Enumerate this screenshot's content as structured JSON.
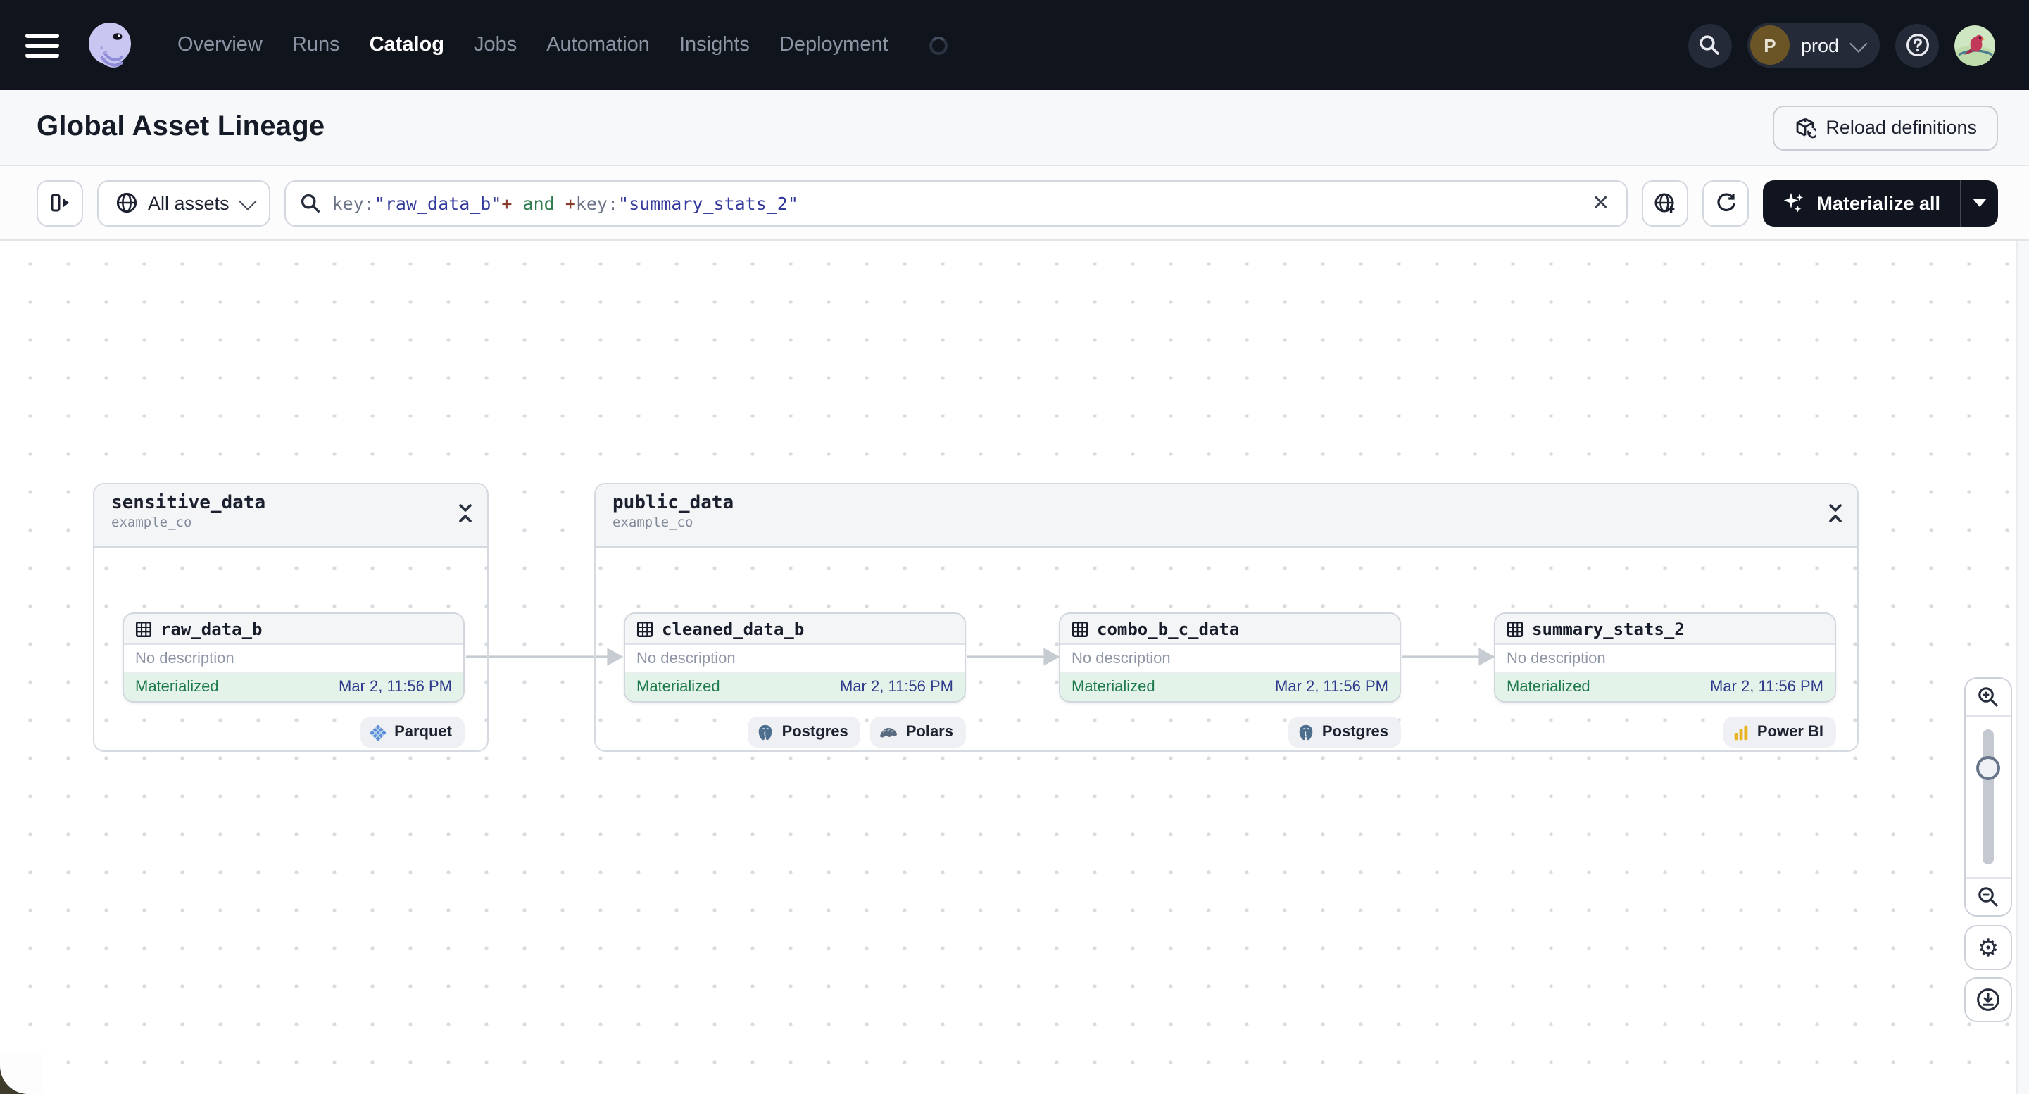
{
  "colors": {
    "nav_bg": "#10141d",
    "primary_button_bg": "#10151f",
    "materialized_green": "#1e7a4c",
    "materialized_bg": "#e4f3ea",
    "timestamp_indigo": "#2e3a8a",
    "query_key": "#6b7487",
    "query_string": "#343a9b",
    "query_operator_plus": "#8a3b2e",
    "query_operator_and": "#2f7d4e"
  },
  "nav": {
    "items": [
      "Overview",
      "Runs",
      "Catalog",
      "Jobs",
      "Automation",
      "Insights",
      "Deployment"
    ],
    "active_item": "Catalog",
    "deployment_switcher": {
      "initial": "P",
      "label": "prod"
    }
  },
  "header": {
    "title": "Global Asset Lineage",
    "reload_button_label": "Reload definitions"
  },
  "toolbar": {
    "scope_button_label": "All assets",
    "search_query": "key:\"raw_data_b\"+ and +key:\"summary_stats_2\"",
    "search_tokens": [
      "key:",
      "\"raw_data_b\"",
      "+",
      " and ",
      "+",
      "key:",
      "\"summary_stats_2\""
    ],
    "materialize_button_label": "Materialize all"
  },
  "graph": {
    "groups": [
      {
        "name": "sensitive_data",
        "location": "example_co",
        "assets": [
          {
            "name": "raw_data_b",
            "description": "No description",
            "status": "Materialized",
            "timestamp": "Mar 2, 11:56 PM",
            "tags": [
              {
                "label": "Parquet",
                "icon": "parquet-icon"
              }
            ]
          }
        ]
      },
      {
        "name": "public_data",
        "location": "example_co",
        "assets": [
          {
            "name": "cleaned_data_b",
            "description": "No description",
            "status": "Materialized",
            "timestamp": "Mar 2, 11:56 PM",
            "tags": [
              {
                "label": "Postgres",
                "icon": "postgres-icon"
              },
              {
                "label": "Polars",
                "icon": "polars-icon"
              }
            ]
          },
          {
            "name": "combo_b_c_data",
            "description": "No description",
            "status": "Materialized",
            "timestamp": "Mar 2, 11:56 PM",
            "tags": [
              {
                "label": "Postgres",
                "icon": "postgres-icon"
              }
            ]
          },
          {
            "name": "summary_stats_2",
            "description": "No description",
            "status": "Materialized",
            "timestamp": "Mar 2, 11:56 PM",
            "tags": [
              {
                "label": "Power BI",
                "icon": "powerbi-icon"
              }
            ]
          }
        ]
      }
    ]
  }
}
